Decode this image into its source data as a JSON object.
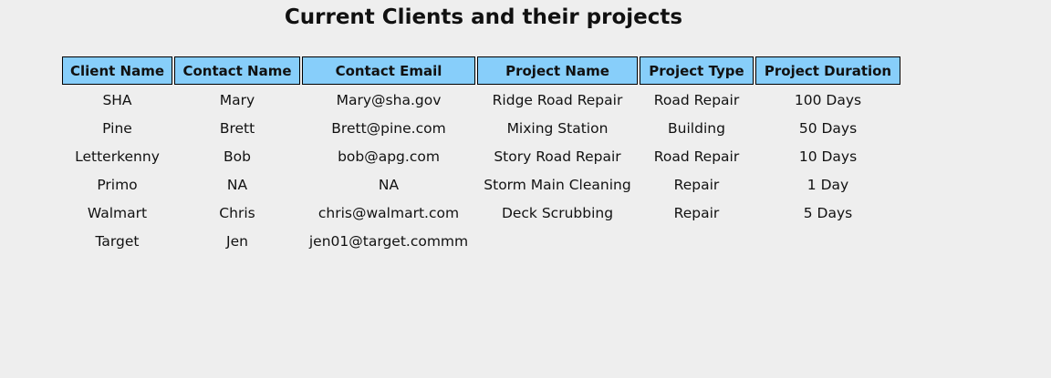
{
  "title": "Current Clients and their projects",
  "columns": [
    "Client Name",
    "Contact Name",
    "Contact Email",
    "Project Name",
    "Project Type",
    "Project Duration"
  ],
  "rows": [
    [
      "SHA",
      "Mary",
      "Mary@sha.gov",
      "Ridge Road Repair",
      "Road Repair",
      "100 Days"
    ],
    [
      "Pine",
      "Brett",
      "Brett@pine.com",
      "Mixing Station",
      "Building",
      "50 Days"
    ],
    [
      "Letterkenny",
      "Bob",
      "bob@apg.com",
      "Story Road Repair",
      "Road Repair",
      "10 Days"
    ],
    [
      "Primo",
      "NA",
      "NA",
      "Storm Main Cleaning",
      "Repair",
      "1 Day"
    ],
    [
      "Walmart",
      "Chris",
      "chris@walmart.com",
      "Deck Scrubbing",
      "Repair",
      "5 Days"
    ],
    [
      "Target",
      "Jen",
      "jen01@target.commm",
      "",
      "",
      ""
    ]
  ],
  "colors": {
    "header_bg": "#87cefa",
    "page_bg": "#eeeeee"
  }
}
